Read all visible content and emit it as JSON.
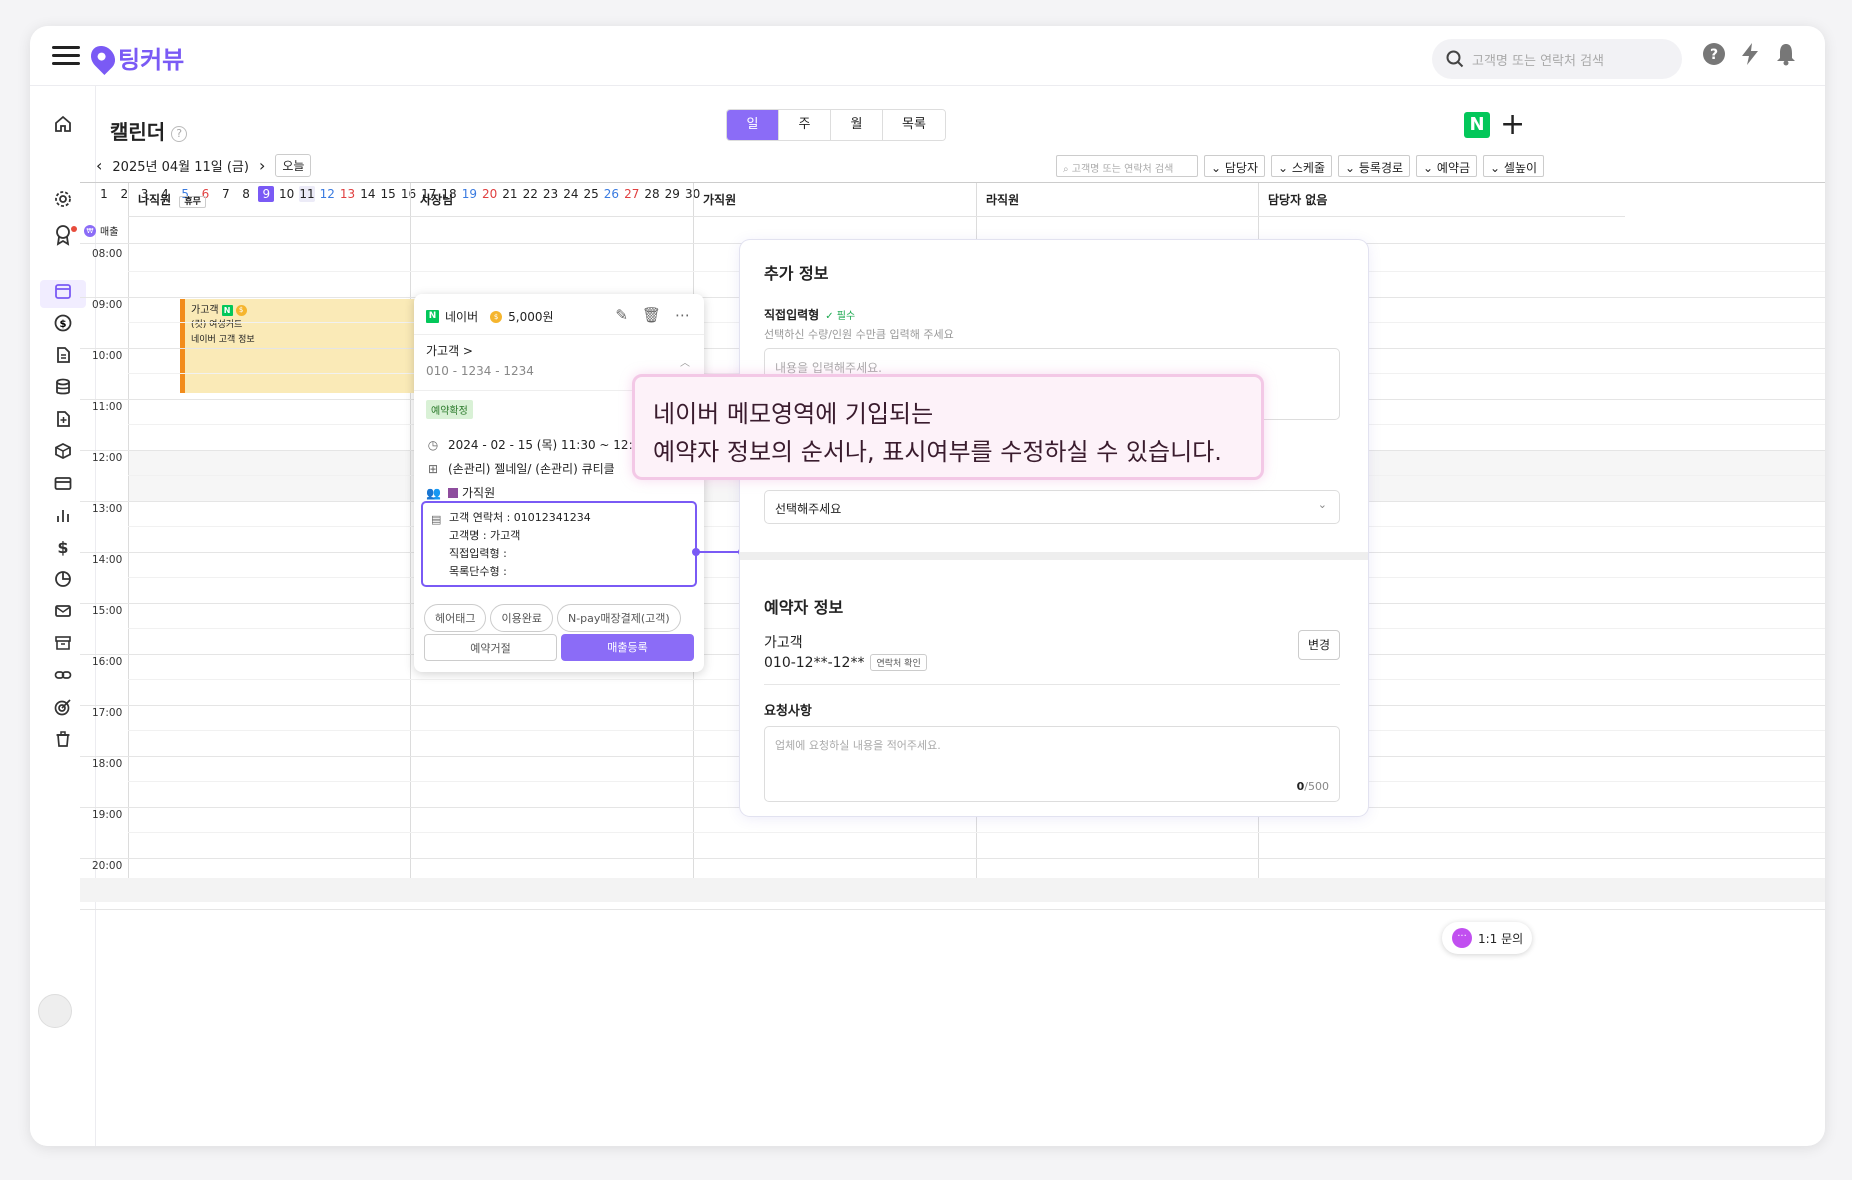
{
  "app": {
    "logo_text": "팅커뷰",
    "search_placeholder": "고객명 또는 연락처 검색",
    "accent": "#7a5af5"
  },
  "header": {
    "title": "캘린더",
    "view_tabs": [
      "일",
      "주",
      "월",
      "목록"
    ],
    "active_view": "일",
    "naver_badge": "N",
    "date_label": "2025년 04월 11일 (금)",
    "today_label": "오늘"
  },
  "filters": {
    "search_placeholder": "고객명 또는 연락처 검색",
    "buttons": [
      "담당자",
      "스케줄",
      "등록경로",
      "예약금",
      "셀높이"
    ]
  },
  "days": [
    "1",
    "2",
    "3",
    "4",
    "5",
    "6",
    "7",
    "8",
    "9",
    "10",
    "11",
    "12",
    "13",
    "14",
    "15",
    "16",
    "17",
    "18",
    "19",
    "20",
    "21",
    "22",
    "23",
    "24",
    "25",
    "26",
    "27",
    "28",
    "29",
    "30"
  ],
  "selected_day": "9",
  "columns": [
    {
      "name": "나직원",
      "badge": "휴무"
    },
    {
      "name": "사장님",
      "badge": ""
    },
    {
      "name": "가직원",
      "badge": ""
    },
    {
      "name": "라직원",
      "badge": ""
    },
    {
      "name": "담당자 없음",
      "badge": ""
    }
  ],
  "sales_label": "매출",
  "times": [
    "08:00",
    "09:00",
    "10:00",
    "11:00",
    "12:00",
    "13:00",
    "14:00",
    "15:00",
    "16:00",
    "17:00",
    "18:00",
    "19:00",
    "20:00"
  ],
  "appointment": {
    "name": "가고객",
    "line1": "(컷) 여성커트",
    "line2": "네이버 고객 정보"
  },
  "popup": {
    "source": "네이버",
    "amount": "5,000원",
    "customer": "가고객 >",
    "phone": "010 - 1234 - 1234",
    "status": "예약확정",
    "datetime": "2024 - 02 - 15 (목) 11:30 ~ 12:30",
    "service": "(손관리) 젤네일/ (손관리) 큐티클",
    "staff": "가직원",
    "memo": [
      "고객 연락처 : 01012341234",
      "고객명 : 가고객",
      "직접입력형 :",
      "목록단수형 :"
    ],
    "tags": [
      "헤어태그",
      "이용완료",
      "N-pay매장결제(고객)"
    ],
    "reject": "예약거절",
    "register": "매출등록"
  },
  "panel": {
    "section1": "추가 정보",
    "field1_label": "직접입력형",
    "field1_required": "✓ 필수",
    "field1_hint": "선택하신 수량/인원 수만큼 입력해 주세요",
    "field1_placeholder": "내용을 입력해주세요.",
    "select_placeholder": "선택해주세요",
    "section2": "예약자 정보",
    "customer_name": "가고객",
    "customer_phone": "010-12**-12**",
    "verify_chip": "연락처 확인",
    "change_button": "변경",
    "request_label": "요청사항",
    "request_placeholder": "업체에 요청하실 내용을 적어주세요.",
    "count_current": "0",
    "count_max": "/500"
  },
  "callout": {
    "line1": "네이버 메모영역에 기입되는",
    "line2": "예약자 정보의 순서나, 표시여부를 수정하실 수 있습니다."
  },
  "inquiry_label": "1:1 문의"
}
